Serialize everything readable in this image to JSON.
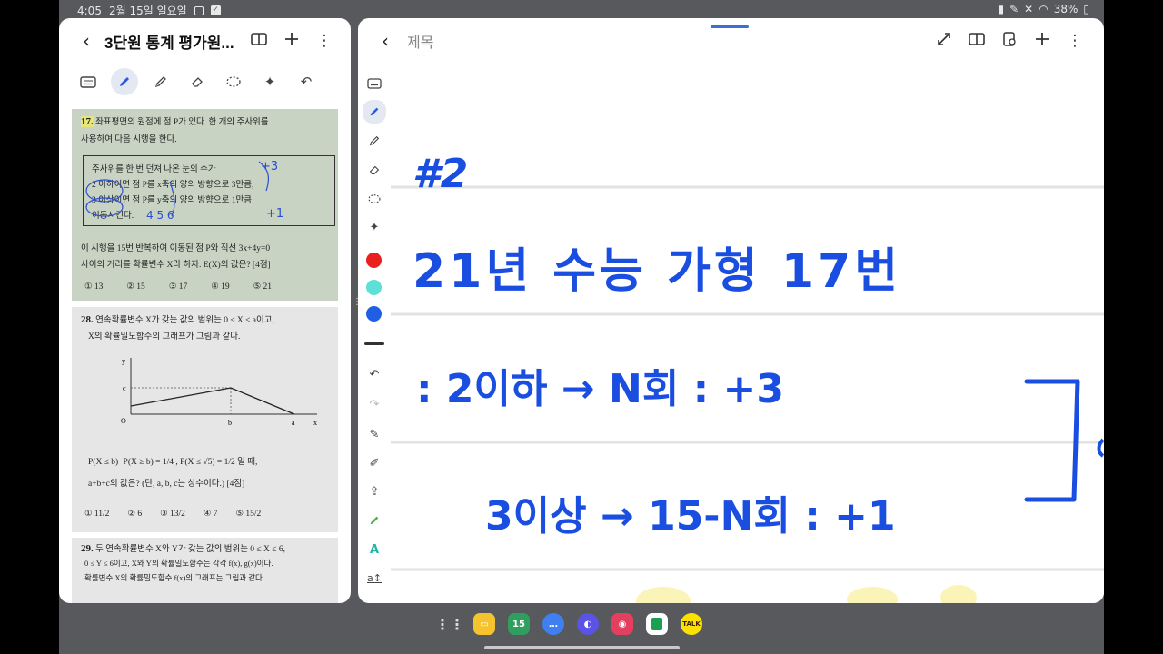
{
  "status_bar": {
    "time": "4:05",
    "date": "2월 15일 일요일",
    "battery": "38%"
  },
  "left_pane": {
    "title": "3단원 통계 평가원...",
    "q17": {
      "number": "17.",
      "line1": "좌표평면의 원점에 점 P가 있다. 한 개의 주사위를",
      "line2": "사용하여 다음 시행을 한다.",
      "box_line1": "주사위를 한 번 던져 나온 눈의 수가",
      "box_line2": "2 이하이면 점 P를 x축의 양의 방향으로 3만큼,",
      "box_line3": "3 이상이면 점 P를 y축의 양의 방향으로 1만큼",
      "box_line4": "이동시킨다.",
      "line3": "이 시행을 15번 반복하여 이동된 점 P와 직선 3x+4y=0",
      "line4": "사이의 거리를 확률변수 X라 하자. E(X)의 값은? [4점]",
      "choices": [
        "① 13",
        "② 15",
        "③ 17",
        "④ 19",
        "⑤ 21"
      ],
      "handwriting_1": "+3",
      "handwriting_2": "4 5 6",
      "handwriting_3": "+1"
    },
    "q28": {
      "number": "28.",
      "line1": "연속확률변수 X가 갖는 값의 범위는 0 ≤ X ≤ a이고,",
      "line2": "X의 확률밀도함수의 그래프가 그림과 같다.",
      "graph_labels": {
        "y": "y",
        "c": "c",
        "o": "O",
        "b": "b",
        "a": "a",
        "x": "x"
      },
      "condition": "P(X ≤ b)−P(X ≥ b) = 1/4 , P(X ≤ √5) = 1/2 일 때,",
      "line3": "a+b+c의 값은? (단, a, b, c는 상수이다.) [4점]",
      "choices": [
        "① 11/2",
        "② 6",
        "③ 13/2",
        "④ 7",
        "⑤ 15/2"
      ]
    },
    "q29": {
      "number": "29.",
      "line1": "두 연속확률변수 X와 Y가 갖는 값의 범위는 0 ≤ X ≤ 6,",
      "line2": "0 ≤ Y ≤ 6이고, X와 Y의 확률밀도함수는 각각 f(x), g(x)이다.",
      "line3": "확률변수 X의 확률밀도함수 f(x)의 그래프는 그림과 같다."
    }
  },
  "right_pane": {
    "title": "제목",
    "handwriting": {
      "line1": "#2",
      "line2": "21년 수능 가형 17번",
      "line3_a": ": 2이하 → N회 : +3",
      "line4_a": "3이상 → 15-N회 : +1"
    },
    "colors": {
      "red": "#e8201e",
      "teal": "#5ee0d8",
      "blue": "#1e5fe6",
      "ink": "#1a4ee0"
    }
  },
  "dock": {
    "apps": [
      "grid-icon",
      "files-icon",
      "calendar-icon",
      "messages-icon",
      "internet-icon",
      "camera-icon",
      "sheets-icon",
      "kakaotalk-icon"
    ],
    "calendar_day": "15",
    "talk_label": "TALK"
  }
}
